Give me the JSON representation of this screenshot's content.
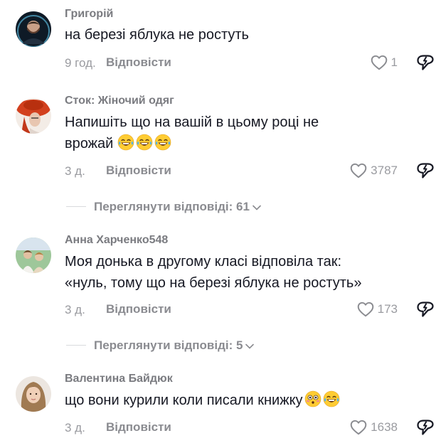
{
  "comments": [
    {
      "username": "Григорій",
      "text": "на березі яблука не ростуть",
      "time": "9 год.",
      "reply_label": "Відповісти",
      "likes": "1"
    },
    {
      "username": "Сток: Жіночий одяг",
      "text": "Напишіть що на вашій в цьому році не\nврожай",
      "time": "3 д.",
      "reply_label": "Відповісти",
      "likes": "3787",
      "view_replies": "Переглянути відповіді: 61"
    },
    {
      "username": "Анна Харченко548",
      "text": "Моя донька в другому класі відповіла так:\n«нуль, тому що на березі яблука не ростуть»",
      "time": "3 д.",
      "reply_label": "Відповісти",
      "likes": "173",
      "view_replies": "Переглянути відповіді: 5"
    },
    {
      "username": "Валентина Байдюк",
      "text": "що вони курили коли писали книжку",
      "time": "3 д.",
      "reply_label": "Відповісти",
      "likes": "1638"
    }
  ],
  "colors": {
    "text": "#161823",
    "secondary": "#8a8b90",
    "muted": "#9a9ba0"
  }
}
